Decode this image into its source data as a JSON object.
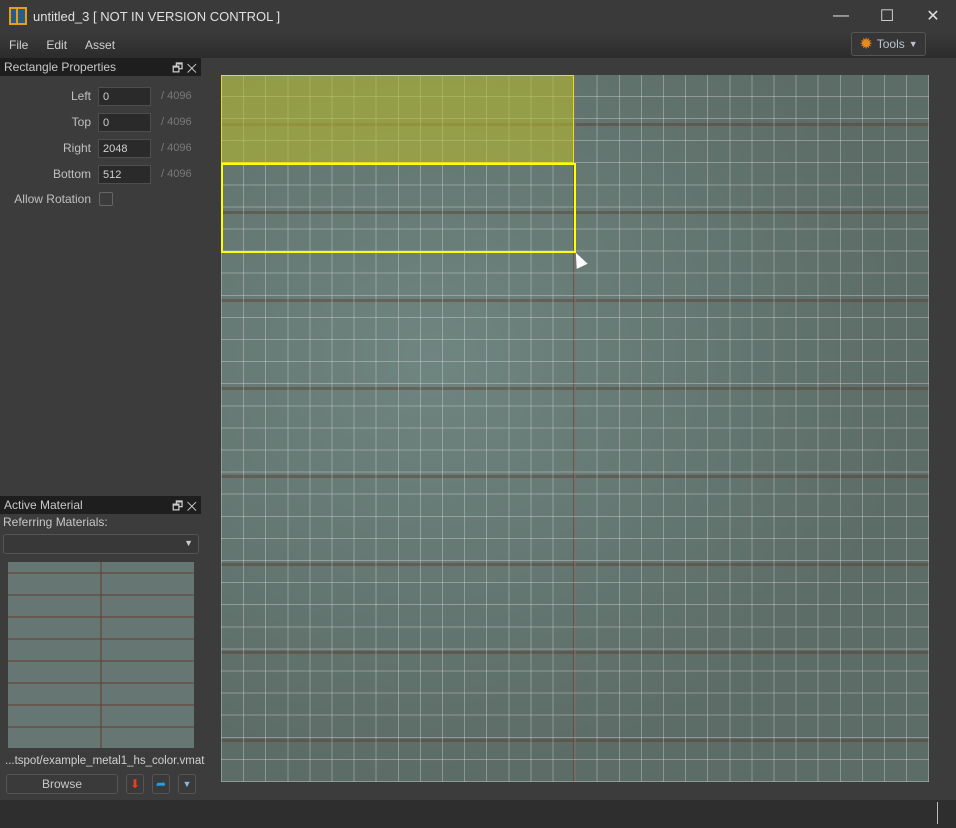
{
  "window": {
    "title": "untitled_3 [ NOT IN VERSION CONTROL ]",
    "minimize": "—",
    "maximize": "☐",
    "close": "✕"
  },
  "menu": [
    "File",
    "Edit",
    "Asset"
  ],
  "tools": {
    "label": "Tools",
    "icon": "gear-icon"
  },
  "rect_panel": {
    "title": "Rectangle Properties",
    "controls": "🗗 ✕",
    "fields": [
      {
        "label": "Left",
        "value": "0",
        "max": "/ 4096"
      },
      {
        "label": "Top",
        "value": "0",
        "max": "/ 4096"
      },
      {
        "label": "Right",
        "value": "2048",
        "max": "/ 4096"
      },
      {
        "label": "Bottom",
        "value": "512",
        "max": "/ 4096"
      }
    ],
    "allow_rotation": {
      "label": "Allow Rotation",
      "checked": false
    }
  },
  "material_panel": {
    "title": "Active Material",
    "controls": "🗗 ✕",
    "referring_label": "Referring Materials:",
    "dropdown_value": "",
    "filename": "...tspot/example_metal1_hs_color.vmat",
    "browse": "Browse"
  },
  "colors": {
    "selection": "#ffff00",
    "accent": "#e88a20"
  }
}
